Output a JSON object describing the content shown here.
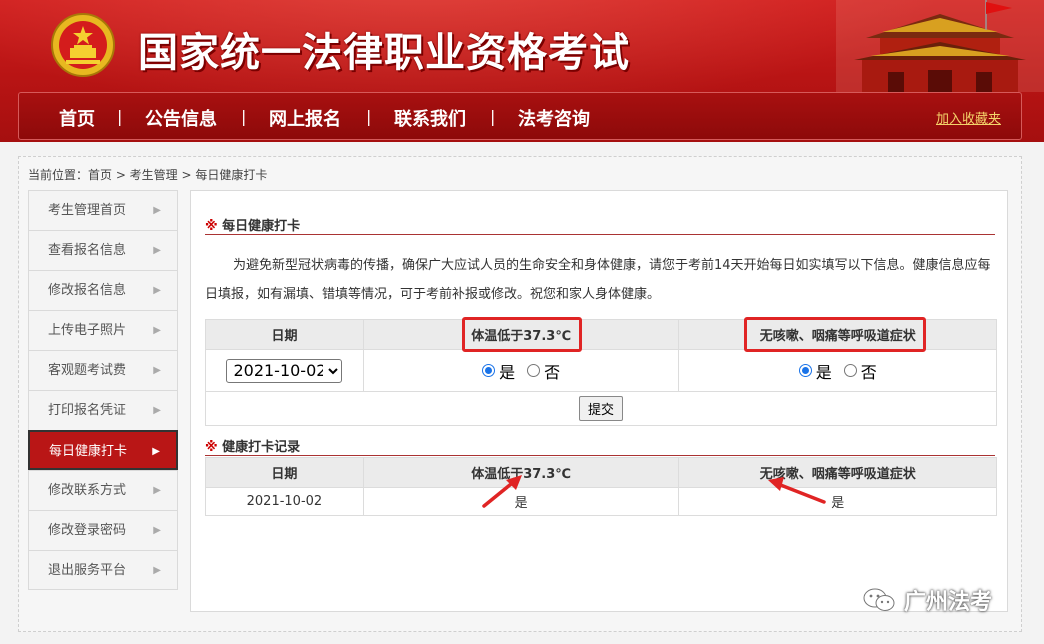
{
  "header": {
    "site_title": "国家统一法律职业资格考试",
    "nav": [
      "首页",
      "公告信息",
      "网上报名",
      "联系我们",
      "法考咨询"
    ],
    "separator": "|",
    "favorite_link": "加入收藏夹"
  },
  "breadcrumb": "当前位置：首页 > 考生管理 > 每日健康打卡",
  "sidebar": {
    "items": [
      {
        "label": "考生管理首页"
      },
      {
        "label": "查看报名信息"
      },
      {
        "label": "修改报名信息"
      },
      {
        "label": "上传电子照片"
      },
      {
        "label": "客观题考试费"
      },
      {
        "label": "打印报名凭证"
      },
      {
        "label": "每日健康打卡"
      },
      {
        "label": "修改联系方式"
      },
      {
        "label": "修改登录密码"
      },
      {
        "label": "退出服务平台"
      }
    ],
    "active_index": 6,
    "arrow": "▶"
  },
  "checkin": {
    "title_star": "※",
    "title": "每日健康打卡",
    "notice": "为避免新型冠状病毒的传播，确保广大应试人员的生命安全和身体健康，请您于考前14天开始每日如实填写以下信息。健康信息应每日填报，如有漏填、错填等情况，可于考前补报或修改。祝您和家人身体健康。",
    "headers": [
      "日期",
      "体温低于37.3℃",
      "无咳嗽、咽痛等呼吸道症状"
    ],
    "date_value": "2021-10-02",
    "date_options": [
      "2021-10-02"
    ],
    "yes_label": "是",
    "no_label": "否",
    "temp_choice": "yes",
    "symptom_choice": "yes",
    "submit_label": "提交"
  },
  "records": {
    "title_star": "※",
    "title": "健康打卡记录",
    "headers": [
      "日期",
      "体温低于37.3℃",
      "无咳嗽、咽痛等呼吸道症状"
    ],
    "rows": [
      {
        "date": "2021-10-02",
        "temp": "是",
        "symptom": "是"
      }
    ]
  },
  "watermark": "广州法考",
  "colors": {
    "header_red": "#c01818",
    "nav_red": "#9a0c0c",
    "active_red": "#b91616",
    "highlight": "#e02424",
    "link_gold": "#f4d36a"
  },
  "icons": {
    "emblem": "national-emblem-icon",
    "gate": "tiananmen-gate-icon",
    "sidebar_arrow": "triangle-right-icon",
    "watermark": "wechat-icon"
  }
}
